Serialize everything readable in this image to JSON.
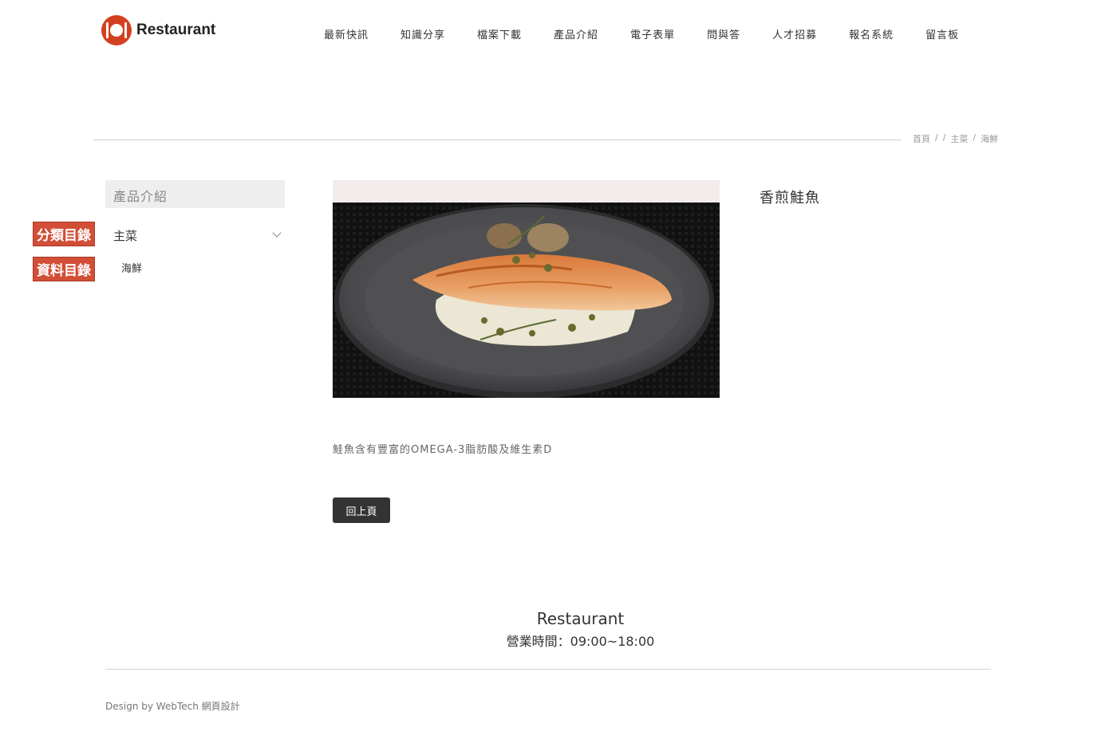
{
  "brand": {
    "name": "Restaurant",
    "color": "#d4401f"
  },
  "nav": [
    {
      "label": "最新快訊"
    },
    {
      "label": "知識分享"
    },
    {
      "label": "檔案下載"
    },
    {
      "label": "產品介紹"
    },
    {
      "label": "電子表單"
    },
    {
      "label": "問與答"
    },
    {
      "label": "人才招募"
    },
    {
      "label": "報名系統"
    },
    {
      "label": "留言板"
    }
  ],
  "breadcrumb": {
    "home": "首頁",
    "level1": "主菜",
    "level2": "海鮮",
    "separator": "/"
  },
  "sidebar": {
    "title": "產品介紹",
    "category": "主菜",
    "subitem": "海鮮",
    "tag_category": "分類目錄",
    "tag_data": "資料目錄",
    "tag_color": "#d24e36"
  },
  "product": {
    "title": "香煎鮭魚",
    "image_icon": "salmon-dish-photo",
    "description": "鮭魚含有豐富的OMEGA-3脂肪酸及維生素D",
    "back_label": "回上頁"
  },
  "footer": {
    "name": "Restaurant",
    "hours": "營業時間：09:00~18:00",
    "credit": "Design by WebTech 網頁設計"
  }
}
